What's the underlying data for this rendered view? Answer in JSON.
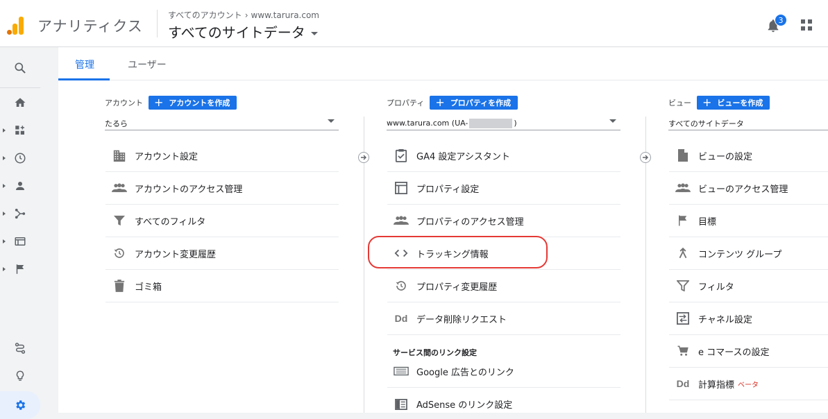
{
  "header": {
    "app_title": "アナリティクス",
    "breadcrumb_account": "すべてのアカウント",
    "breadcrumb_sep": "›",
    "breadcrumb_site": "www.tarura.com",
    "property_name": "すべてのサイトデータ",
    "notification_count": "3"
  },
  "tabs": [
    {
      "label": "管理",
      "active": true
    },
    {
      "label": "ユーザー",
      "active": false
    }
  ],
  "account": {
    "title": "アカウント",
    "create_label": "アカウントを作成",
    "selected": "たるら",
    "items": [
      {
        "icon": "building-icon",
        "label": "アカウント設定"
      },
      {
        "icon": "people-icon",
        "label": "アカウントのアクセス管理"
      },
      {
        "icon": "filter-icon",
        "label": "すべてのフィルタ"
      },
      {
        "icon": "history-icon",
        "label": "アカウント変更履歴"
      },
      {
        "icon": "trash-icon",
        "label": "ゴミ箱"
      }
    ]
  },
  "property": {
    "title": "プロパティ",
    "create_label": "プロパティを作成",
    "selected_prefix": "www.tarura.com (UA-",
    "selected_suffix": ")",
    "items": [
      {
        "icon": "checklist-icon",
        "label": "GA4 設定アシスタント"
      },
      {
        "icon": "layout-icon",
        "label": "プロパティ設定"
      },
      {
        "icon": "people-icon",
        "label": "プロパティのアクセス管理"
      },
      {
        "icon": "code-icon",
        "label": "トラッキング情報"
      },
      {
        "icon": "history-icon",
        "label": "プロパティ変更履歴"
      },
      {
        "icon": "dd-icon",
        "label": "データ削除リクエスト"
      }
    ],
    "links_section_title": "サービス間のリンク設定",
    "link_items": [
      {
        "icon": "ads-icon",
        "label": "Google 広告とのリンク"
      },
      {
        "icon": "adsense-icon",
        "label": "AdSense のリンク設定"
      }
    ]
  },
  "view": {
    "title": "ビュー",
    "create_label": "ビューを作成",
    "selected": "すべてのサイトデータ",
    "items": [
      {
        "icon": "document-icon",
        "label": "ビューの設定"
      },
      {
        "icon": "people-icon",
        "label": "ビューのアクセス管理"
      },
      {
        "icon": "flag-icon",
        "label": "目標"
      },
      {
        "icon": "content-group-icon",
        "label": "コンテンツ グループ"
      },
      {
        "icon": "filter-icon",
        "label": "フィルタ"
      },
      {
        "icon": "channel-icon",
        "label": "チャネル設定"
      },
      {
        "icon": "cart-icon",
        "label": "e コマースの設定"
      },
      {
        "icon": "dd-icon",
        "label": "計算指標"
      }
    ],
    "beta_label": "ベータ"
  },
  "colors": {
    "accent": "#1a73e8",
    "highlight": "#e53935",
    "logo_orange": "#f9ab00",
    "logo_dark": "#e37400"
  }
}
